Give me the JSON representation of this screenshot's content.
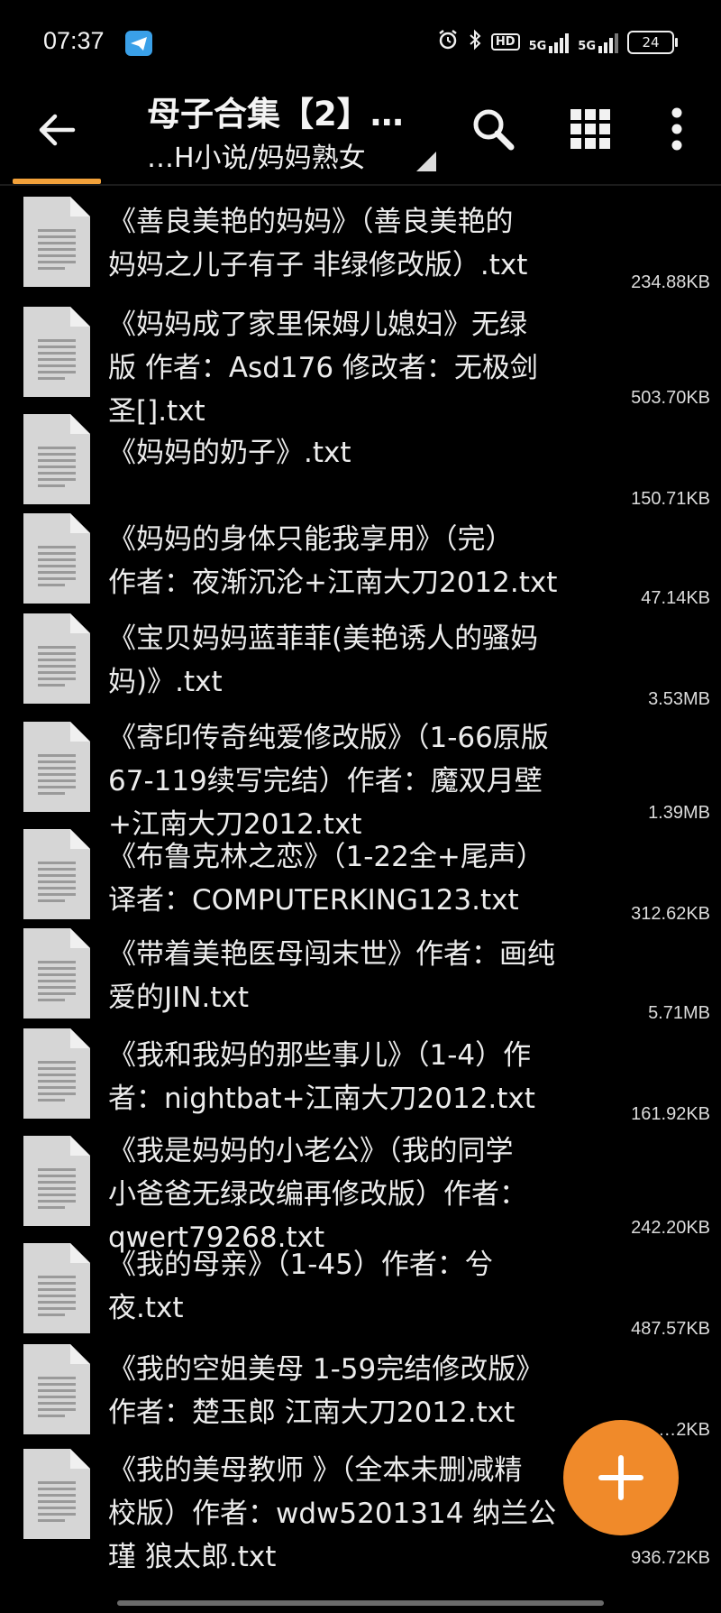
{
  "status": {
    "time": "07:37",
    "hd_label": "HD",
    "net1": "5G",
    "net2": "5G",
    "battery": "24"
  },
  "toolbar": {
    "title": "母子合集【2】…",
    "subtitle": "…H小说/妈妈熟女"
  },
  "files": [
    {
      "name": "《善良美艳的妈妈》（善良美艳的\n妈妈之儿子有子 非绿修改版）.txt",
      "size": "234.88KB"
    },
    {
      "name": "《妈妈成了家里保姆儿媳妇》无绿\n版 作者：Asd176 修改者：无极剑\n圣[].txt",
      "size": "503.70KB"
    },
    {
      "name": "《妈妈的奶子》.txt",
      "size": "150.71KB"
    },
    {
      "name": "《妈妈的身体只能我享用》（完）\n作者：夜渐沉沦+江南大刀2012.txt",
      "size": "47.14KB"
    },
    {
      "name": "《宝贝妈妈蓝菲菲(美艳诱人的骚妈\n妈)》.txt",
      "size": "3.53MB"
    },
    {
      "name": "《寄印传奇纯爱修改版》（1-66原版\n67-119续写完结）作者：魔双月壁\n+江南大刀2012.txt",
      "size": "1.39MB"
    },
    {
      "name": "《布鲁克林之恋》（1-22全+尾声）\n译者：COMPUTERKING123.txt",
      "size": "312.62KB"
    },
    {
      "name": "《带着美艳医母闯末世》作者：画纯\n爱的JIN.txt",
      "size": "5.71MB"
    },
    {
      "name": "《我和我妈的那些事儿》（1-4）作\n者：nightbat+江南大刀2012.txt",
      "size": "161.92KB"
    },
    {
      "name": "《我是妈妈的小老公》（我的同学\n小爸爸无绿改编再修改版）作者：\nqwert79268.txt",
      "size": "242.20KB"
    },
    {
      "name": "《我的母亲》（1-45）作者：兮\n夜.txt",
      "size": "487.57KB"
    },
    {
      "name": "《我的空姐美母 1-59完结修改版》\n作者：楚玉郎 江南大刀2012.txt",
      "size": "…2KB"
    },
    {
      "name": "《我的美母教师 》（全本未删减精\n校版）作者：wdw5201314 纳兰公\n瑾 狼太郎.txt",
      "size": "936.72KB"
    }
  ],
  "icons": {
    "back": "arrow-left-icon",
    "search": "search-icon",
    "grid": "grid-view-icon",
    "more": "more-vert-icon",
    "fab": "plus-icon",
    "file": "text-file-icon"
  },
  "colors": {
    "accent": "#f08a2a",
    "tab_indicator": "#f2a13a",
    "background": "#000000",
    "file_icon": "#d6d6d6"
  }
}
